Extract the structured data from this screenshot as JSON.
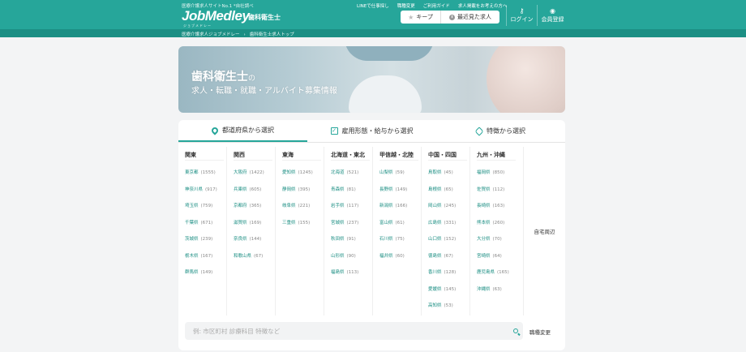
{
  "header": {
    "tagline": "医療介護求人サイトNo.1 *自社調べ",
    "logo": "JobMedley",
    "logo_sub": "ジョブメドレー",
    "occupation": "歯科衛生士",
    "links": [
      "LINEで仕事探し",
      "職種変更",
      "ご利用ガイド",
      "求人掲載をお考えの方へ"
    ],
    "keep_label": "キープ",
    "recent_label": "最近見た求人",
    "login_label": "ログイン",
    "signup_label": "会員登録",
    "icons": {
      "keep": "star-icon",
      "recent": "clock-icon",
      "login": "key-icon",
      "signup": "user-icon"
    }
  },
  "breadcrumb": [
    "医療介護求人ジョブメドレー",
    "歯科衛生士求人トップ"
  ],
  "hero": {
    "title": "歯科衛生士",
    "title_suffix": "の",
    "subtitle": "求人・転職・就職・アルバイト募集情報"
  },
  "tabs": [
    {
      "label": "都道府県から選択",
      "icon": "map-pin-icon",
      "active": true
    },
    {
      "label": "雇用形態・給与から選択",
      "icon": "checkbox-icon",
      "active": false
    },
    {
      "label": "特徴から選択",
      "icon": "tag-icon",
      "active": false
    }
  ],
  "regions": [
    {
      "name": "関東",
      "prefs": [
        {
          "name": "東京都",
          "count": "(1555)"
        },
        {
          "name": "神奈川県",
          "count": "(917)"
        },
        {
          "name": "埼玉県",
          "count": "(759)"
        },
        {
          "name": "千葉県",
          "count": "(671)"
        },
        {
          "name": "茨城県",
          "count": "(239)"
        },
        {
          "name": "栃木県",
          "count": "(167)"
        },
        {
          "name": "群馬県",
          "count": "(149)"
        }
      ]
    },
    {
      "name": "関西",
      "prefs": [
        {
          "name": "大阪府",
          "count": "(1422)"
        },
        {
          "name": "兵庫県",
          "count": "(605)"
        },
        {
          "name": "京都府",
          "count": "(365)"
        },
        {
          "name": "滋賀県",
          "count": "(169)"
        },
        {
          "name": "奈良県",
          "count": "(144)"
        },
        {
          "name": "和歌山県",
          "count": "(67)"
        }
      ]
    },
    {
      "name": "東海",
      "prefs": [
        {
          "name": "愛知県",
          "count": "(1245)"
        },
        {
          "name": "静岡県",
          "count": "(395)"
        },
        {
          "name": "岐阜県",
          "count": "(221)"
        },
        {
          "name": "三重県",
          "count": "(155)"
        }
      ]
    },
    {
      "name": "北海道・東北",
      "prefs": [
        {
          "name": "北海道",
          "count": "(521)"
        },
        {
          "name": "青森県",
          "count": "(81)"
        },
        {
          "name": "岩手県",
          "count": "(117)"
        },
        {
          "name": "宮城県",
          "count": "(237)"
        },
        {
          "name": "秋田県",
          "count": "(91)"
        },
        {
          "name": "山形県",
          "count": "(90)"
        },
        {
          "name": "福島県",
          "count": "(113)"
        }
      ]
    },
    {
      "name": "甲信越・北陸",
      "prefs": [
        {
          "name": "山梨県",
          "count": "(59)"
        },
        {
          "name": "長野県",
          "count": "(149)"
        },
        {
          "name": "新潟県",
          "count": "(166)"
        },
        {
          "name": "富山県",
          "count": "(61)"
        },
        {
          "name": "石川県",
          "count": "(75)"
        },
        {
          "name": "福井県",
          "count": "(60)"
        }
      ]
    },
    {
      "name": "中国・四国",
      "prefs": [
        {
          "name": "鳥取県",
          "count": "(45)"
        },
        {
          "name": "島根県",
          "count": "(65)"
        },
        {
          "name": "岡山県",
          "count": "(245)"
        },
        {
          "name": "広島県",
          "count": "(331)"
        },
        {
          "name": "山口県",
          "count": "(152)"
        },
        {
          "name": "徳島県",
          "count": "(67)"
        },
        {
          "name": "香川県",
          "count": "(128)"
        },
        {
          "name": "愛媛県",
          "count": "(145)"
        },
        {
          "name": "高知県",
          "count": "(53)"
        }
      ]
    },
    {
      "name": "九州・沖縄",
      "prefs": [
        {
          "name": "福岡県",
          "count": "(850)"
        },
        {
          "name": "佐賀県",
          "count": "(112)"
        },
        {
          "name": "長崎県",
          "count": "(163)"
        },
        {
          "name": "熊本県",
          "count": "(260)"
        },
        {
          "name": "大分県",
          "count": "(70)"
        },
        {
          "name": "宮崎県",
          "count": "(64)"
        },
        {
          "name": "鹿児島県",
          "count": "(165)"
        },
        {
          "name": "沖縄県",
          "count": "(63)"
        }
      ]
    }
  ],
  "home_near": "自宅周辺",
  "search": {
    "placeholder": "例: 市区町村 診療科目 特徴など",
    "value": ""
  },
  "change_occupation": "職種変更",
  "colors": {
    "brand": "#26a69a",
    "brand_dark": "#1c8f84",
    "link": "#1b8e83"
  }
}
